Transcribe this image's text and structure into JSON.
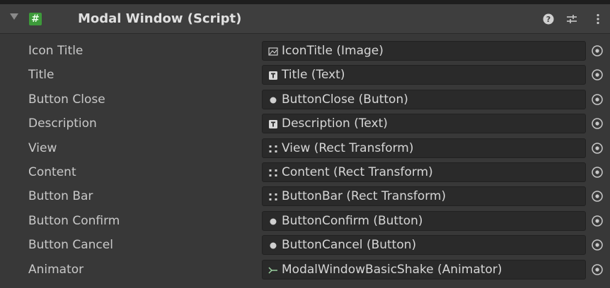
{
  "component": {
    "title": "Modal Window (Script)",
    "icon": "script-hash-icon",
    "header_icons": [
      "help-icon",
      "presets-icon",
      "kebab-menu-icon"
    ]
  },
  "colors": {
    "panel_bg": "#383838",
    "field_bg": "#2a2a2a",
    "script_icon": "#3d9a3a"
  },
  "fields": [
    {
      "label": "Icon Title",
      "value": "IconTitle (Image)",
      "type_icon": "image-icon"
    },
    {
      "label": "Title",
      "value": "Title (Text)",
      "type_icon": "text-icon"
    },
    {
      "label": "Button Close",
      "value": "ButtonClose (Button)",
      "type_icon": "button-icon"
    },
    {
      "label": "Description",
      "value": "Description (Text)",
      "type_icon": "text-icon"
    },
    {
      "label": "View",
      "value": "View (Rect Transform)",
      "type_icon": "rect-transform-icon"
    },
    {
      "label": "Content",
      "value": "Content (Rect Transform)",
      "type_icon": "rect-transform-icon"
    },
    {
      "label": "Button Bar",
      "value": "ButtonBar (Rect Transform)",
      "type_icon": "rect-transform-icon"
    },
    {
      "label": "Button Confirm",
      "value": "ButtonConfirm (Button)",
      "type_icon": "button-icon"
    },
    {
      "label": "Button Cancel",
      "value": "ButtonCancel (Button)",
      "type_icon": "button-icon"
    },
    {
      "label": "Animator",
      "value": "ModalWindowBasicShake (Animator)",
      "type_icon": "animator-icon"
    }
  ]
}
